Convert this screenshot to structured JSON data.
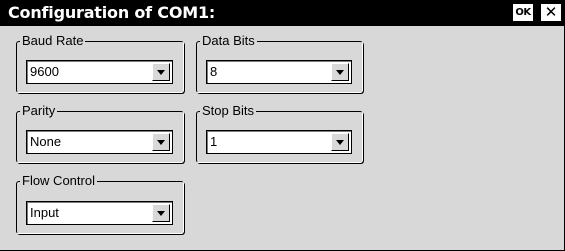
{
  "window": {
    "title": "Configuration of COM1:",
    "ok_label": "OK",
    "close_label": "✕"
  },
  "groups": {
    "baud_rate": {
      "label": "Baud Rate",
      "value": "9600"
    },
    "data_bits": {
      "label": "Data Bits",
      "value": "8"
    },
    "parity": {
      "label": "Parity",
      "value": "None"
    },
    "stop_bits": {
      "label": "Stop Bits",
      "value": "1"
    },
    "flow_control": {
      "label": "Flow Control",
      "value": "Input"
    }
  },
  "icons": {
    "dropdown": "chevron-down-icon",
    "close": "close-icon"
  }
}
